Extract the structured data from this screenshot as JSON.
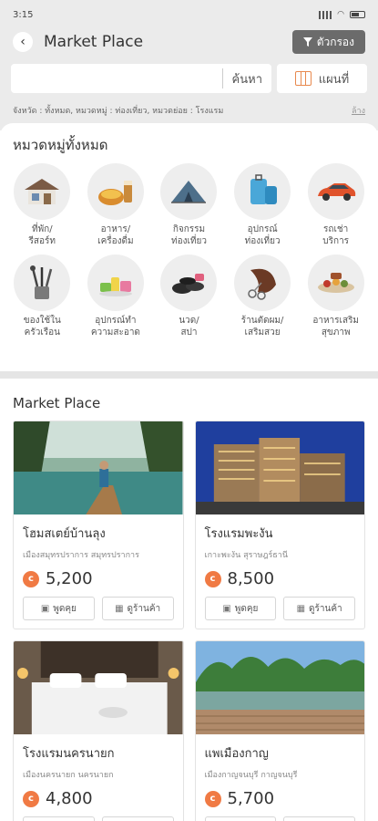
{
  "status_bar": {
    "time": "3:15",
    "battery": ""
  },
  "header": {
    "title": "Market Place",
    "filter_label": "ตัวกรอง"
  },
  "search": {
    "placeholder": "",
    "value": "",
    "search_label": "ค้นหา",
    "map_label": "แผนที่"
  },
  "filter_summary": {
    "text": "จังหวัด : ทั้งหมด, หมวดหมู่ : ท่องเที่ยว, หมวดย่อย : โรงแรม",
    "clear_label": "ล้าง"
  },
  "categories": {
    "title": "หมวดหมู่ทั้งหมด",
    "items": [
      {
        "label": "ที่พัก/\nรีสอร์ท",
        "icon": "house-icon"
      },
      {
        "label": "อาหาร/\nเครื่องดื่ม",
        "icon": "food-icon"
      },
      {
        "label": "กิจกรรม\nท่องเที่ยว",
        "icon": "tent-icon"
      },
      {
        "label": "อุปกรณ์\nท่องเที่ยว",
        "icon": "luggage-icon"
      },
      {
        "label": "รถเช่า\nบริการ",
        "icon": "car-icon"
      },
      {
        "label": "ของใช้ใน\nครัวเรือน",
        "icon": "kitchen-utensils-icon"
      },
      {
        "label": "อุปกรณ์ทำ\nความสะอาด",
        "icon": "cleaning-supplies-icon"
      },
      {
        "label": "นวด/\nสปา",
        "icon": "spa-stones-icon"
      },
      {
        "label": "ร้านตัดผม/\nเสริมสวย",
        "icon": "hair-salon-icon"
      },
      {
        "label": "อาหารเสริม\nสุขภาพ",
        "icon": "supplement-icon"
      }
    ]
  },
  "market": {
    "title": "Market Place",
    "chat_label": "พูดคุย",
    "shop_label": "ดูร้านค้า",
    "items": [
      {
        "name": "โฮมสเตย์บ้านลุง",
        "location": "เมืองสมุทรปราการ สมุทรปราการ",
        "price": "5,200",
        "image": "river-boat-photo"
      },
      {
        "name": "โรงแรมพะงัน",
        "location": "เกาะพะงัน สุราษฎร์ธานี",
        "price": "8,500",
        "image": "hotel-tower-photo"
      },
      {
        "name": "โรงแรมนครนายก",
        "location": "เมืองนครนายก นครนายก",
        "price": "4,800",
        "image": "hotel-room-photo"
      },
      {
        "name": "แพเมืองกาญ",
        "location": "เมืองกาญจนบุรี กาญจนบุรี",
        "price": "5,700",
        "image": "river-raft-photo"
      }
    ]
  }
}
